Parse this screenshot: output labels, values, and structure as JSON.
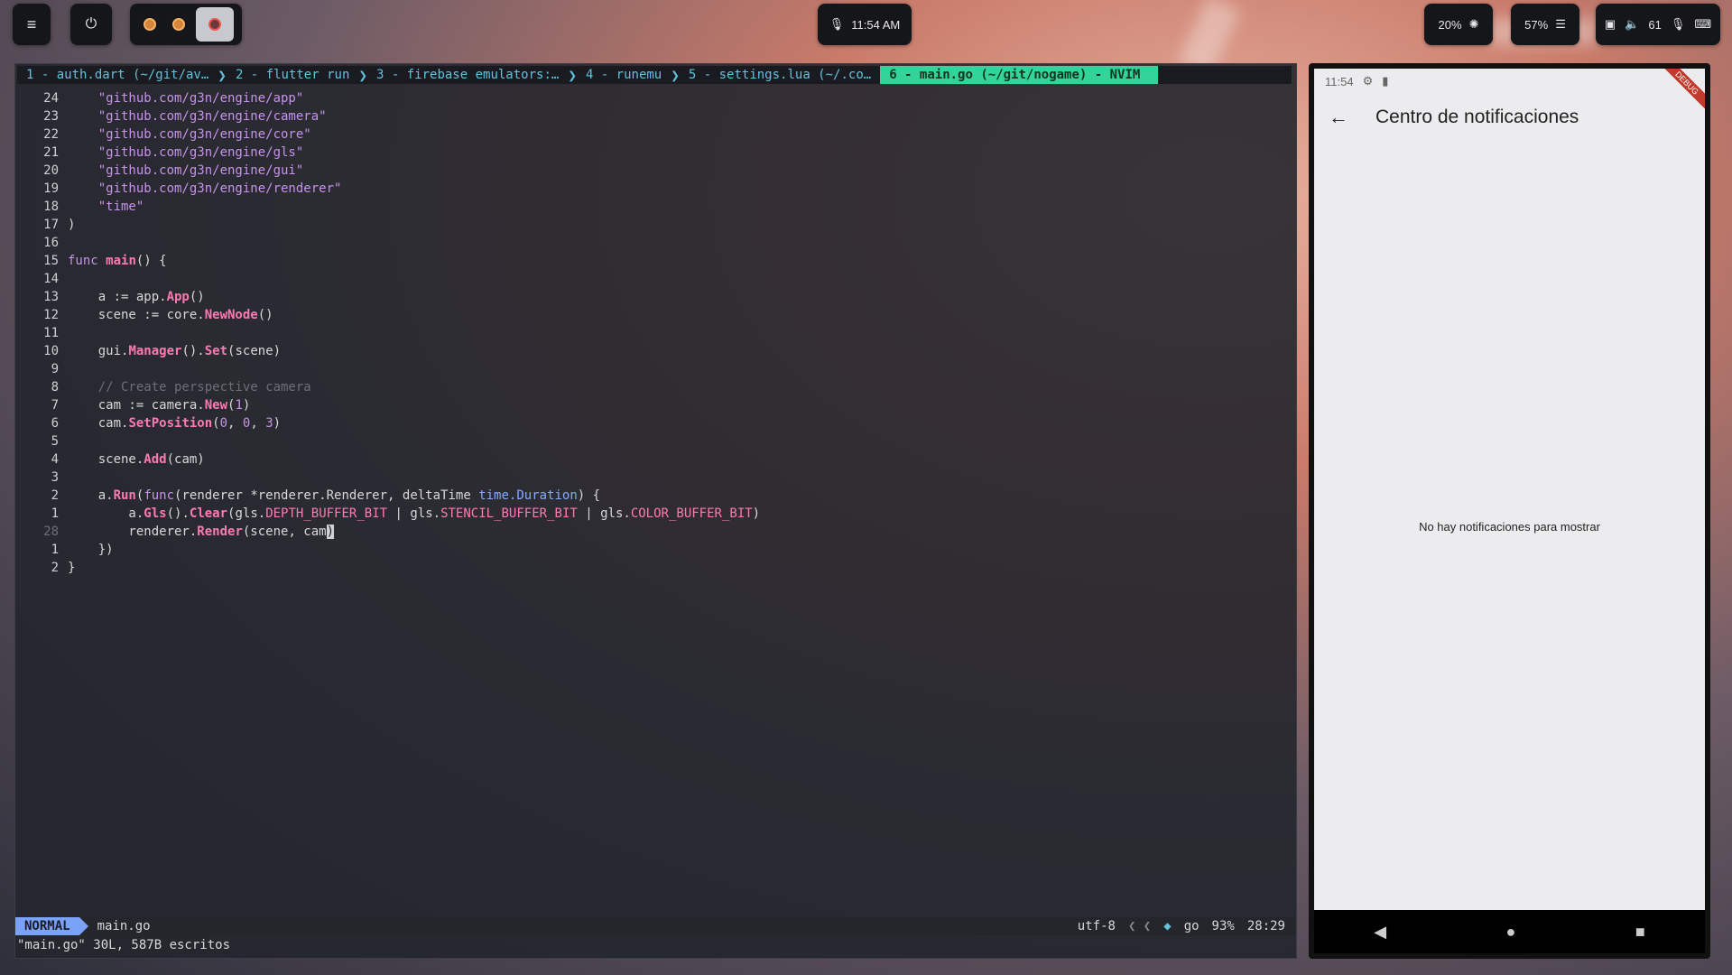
{
  "topbar": {
    "menu_icon": "≡",
    "power_icon": "⏻",
    "time": "11:54 AM",
    "brightness": "20%",
    "cpu": "57%",
    "volume": "61"
  },
  "editor": {
    "tabs": [
      "1 - auth.dart (~/git/av…",
      "2 - flutter run",
      "3 - firebase emulators:…",
      "4 - runemu",
      "5 - settings.lua (~/.co…",
      "6 - main.go (~/git/nogame) - NVIM"
    ],
    "lines": [
      {
        "n": "24",
        "t": "    \"github.com/g3n/engine/app\""
      },
      {
        "n": "23",
        "t": "    \"github.com/g3n/engine/camera\""
      },
      {
        "n": "22",
        "t": "    \"github.com/g3n/engine/core\""
      },
      {
        "n": "21",
        "t": "    \"github.com/g3n/engine/gls\""
      },
      {
        "n": "20",
        "t": "    \"github.com/g3n/engine/gui\""
      },
      {
        "n": "19",
        "t": "    \"github.com/g3n/engine/renderer\""
      },
      {
        "n": "18",
        "t": "    \"time\""
      },
      {
        "n": "17",
        "t": ")"
      },
      {
        "n": "16",
        "t": ""
      },
      {
        "n": "15",
        "t": "func main() {"
      },
      {
        "n": "14",
        "t": ""
      },
      {
        "n": "13",
        "t": "    a := app.App()"
      },
      {
        "n": "12",
        "t": "    scene := core.NewNode()"
      },
      {
        "n": "11",
        "t": ""
      },
      {
        "n": "10",
        "t": "    gui.Manager().Set(scene)"
      },
      {
        "n": "9",
        "t": ""
      },
      {
        "n": "8",
        "t": "    // Create perspective camera"
      },
      {
        "n": "7",
        "t": "    cam := camera.New(1)"
      },
      {
        "n": "6",
        "t": "    cam.SetPosition(0, 0, 3)"
      },
      {
        "n": "5",
        "t": ""
      },
      {
        "n": "4",
        "t": "    scene.Add(cam)"
      },
      {
        "n": "3",
        "t": ""
      },
      {
        "n": "2",
        "t": "    a.Run(func(renderer *renderer.Renderer, deltaTime time.Duration) {"
      },
      {
        "n": "1",
        "t": "        a.Gls().Clear(gls.DEPTH_BUFFER_BIT | gls.STENCIL_BUFFER_BIT | gls.COLOR_BUFFER_BIT)"
      },
      {
        "n": "28",
        "t": "        renderer.Render(scene, cam)"
      },
      {
        "n": "1",
        "t": "    })"
      },
      {
        "n": "2",
        "t": "}"
      }
    ],
    "mode": "NORMAL",
    "filename": "main.go",
    "encoding": "utf-8",
    "filetype": "go",
    "percent": "93%",
    "position": "28:29",
    "cmdline": "\"main.go\" 30L, 587B escritos"
  },
  "phone": {
    "time": "11:54",
    "title": "Centro de notificaciones",
    "empty_message": "No hay notificaciones para mostrar",
    "debug_label": "DEBUG"
  }
}
